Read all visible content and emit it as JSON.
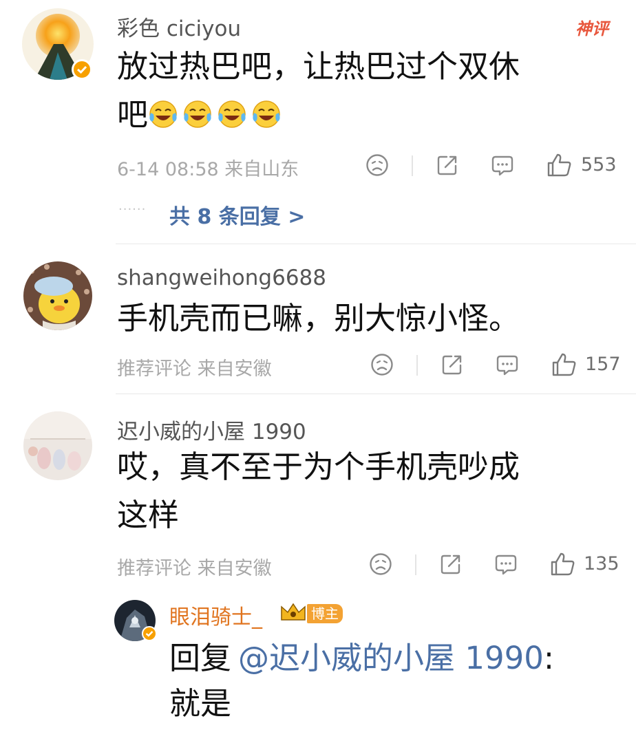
{
  "badges": {
    "hot_label": "神评",
    "blogger_label": "博主"
  },
  "comments": [
    {
      "username": "彩色 ciciyou",
      "text": "放过热巴吧，让热巴过个双休吧",
      "text_line1": "放过热巴吧，让热巴过个双休",
      "text_line2": "吧",
      "emoji_count": 4,
      "meta": "6-14 08:58 来自山东",
      "likes": "553",
      "replies_link": "共 8 条回复 >",
      "replies_dots": "······"
    },
    {
      "username": "shangweihong6688",
      "text": "手机壳而已嘛，别大惊小怪。",
      "meta": "推荐评论 来自安徽",
      "likes": "157"
    },
    {
      "username": "迟小威的小屋 1990",
      "text": "哎，真不至于为个手机壳吵成这样",
      "text_line1": "哎，真不至于为个手机壳吵成",
      "text_line2": "这样",
      "meta": "推荐评论 来自安徽",
      "likes": "135"
    }
  ],
  "reply": {
    "username": "眼泪骑士_",
    "prefix": "回复",
    "mention": "@迟小威的小屋 1990",
    "colon": ":",
    "text": "就是"
  },
  "colors": {
    "link": "#4a6fa5",
    "reply_name": "#e0741f",
    "hot_badge": "#e8573d",
    "meta": "#a8a8a8"
  }
}
